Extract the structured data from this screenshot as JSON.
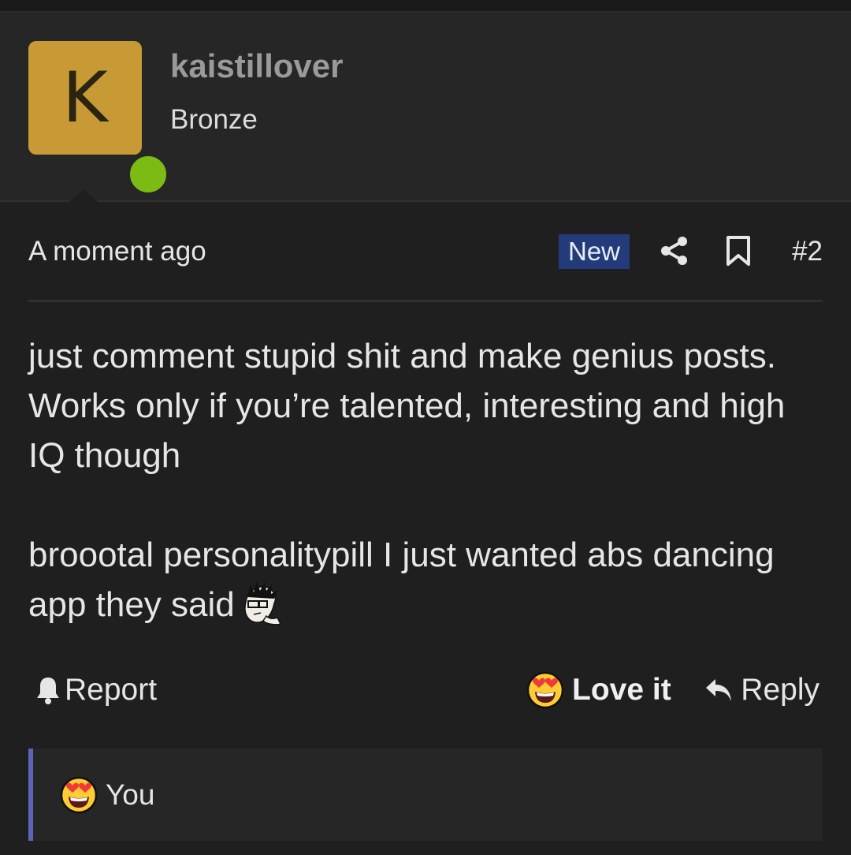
{
  "user": {
    "avatar_letter": "K",
    "avatar_color": "#c89a35",
    "online_color": "#7cbb14",
    "username": "kaistillover",
    "rank": "Bronze"
  },
  "post": {
    "timestamp": "A moment ago",
    "badge": "New",
    "number": "#2",
    "paragraph_1": "just comment stupid shit and make genius posts. Works only if you’re talented, interesting and high IQ though",
    "paragraph_2": "broootal personalitypill I just wanted abs dancing app they said",
    "inline_emoji": "sketch-face-emoji"
  },
  "actions": {
    "report_label": "Report",
    "love_label": "Love it",
    "reply_label": "Reply"
  },
  "reactions": {
    "user": "You",
    "emoji": "heart-eyes-emoji",
    "accent_color": "#5b64b8"
  },
  "icons": [
    "share-icon",
    "bookmark-icon",
    "bell-icon",
    "heart-eyes-emoji",
    "reply-arrow-icon"
  ]
}
